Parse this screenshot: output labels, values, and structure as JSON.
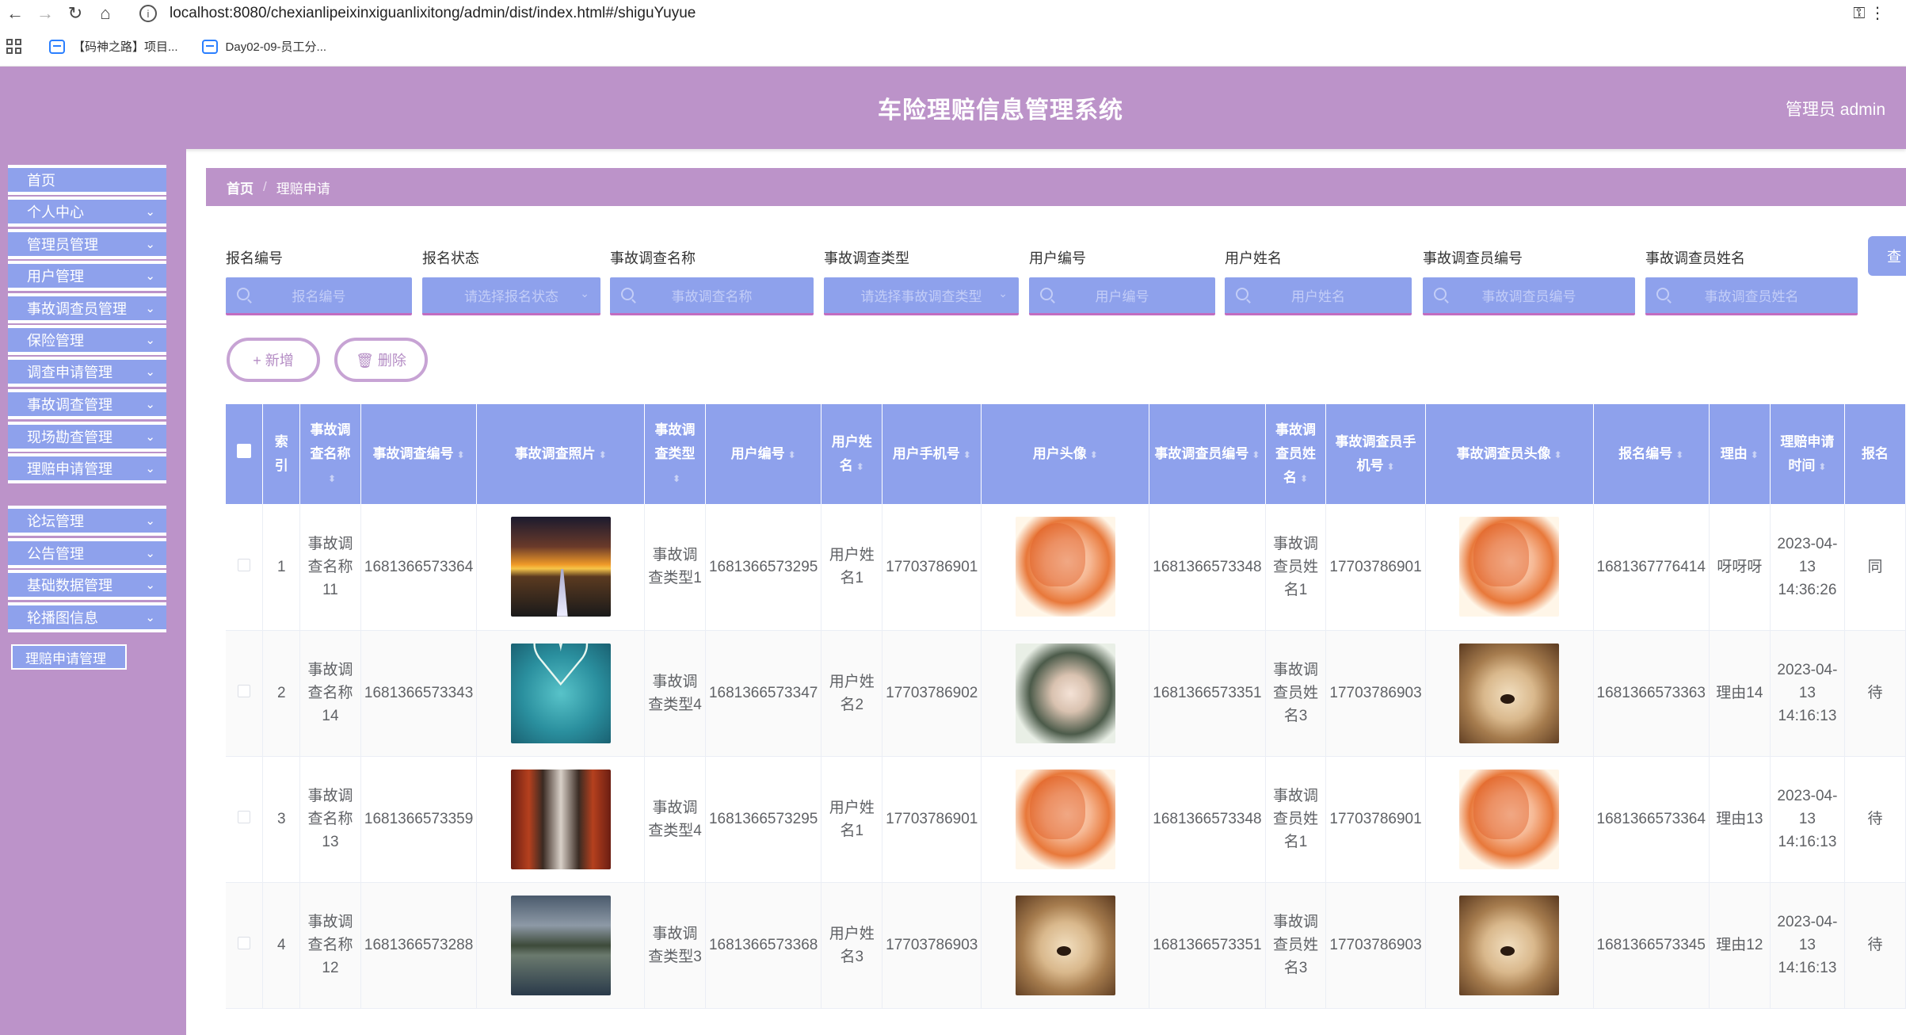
{
  "browser": {
    "url": "localhost:8080/chexianlipeixinxiguanlixitong/admin/dist/index.html#/shiguYuyue",
    "bookmarks": [
      "【码神之路】项目...",
      "Day02-09-员工分..."
    ]
  },
  "header": {
    "title": "车险理赔信息管理系统",
    "user": "管理员 admin"
  },
  "sidebar": {
    "items": [
      {
        "label": "首页",
        "has_arrow": false
      },
      {
        "label": "个人中心",
        "has_arrow": true
      },
      {
        "label": "管理员管理",
        "has_arrow": true
      },
      {
        "label": "用户管理",
        "has_arrow": true
      },
      {
        "label": "事故调查员管理",
        "has_arrow": true
      },
      {
        "label": "保险管理",
        "has_arrow": true
      },
      {
        "label": "调查申请管理",
        "has_arrow": true
      },
      {
        "label": "事故调查管理",
        "has_arrow": true
      },
      {
        "label": "现场勘查管理",
        "has_arrow": true
      },
      {
        "label": "理赔申请管理",
        "has_arrow": true
      },
      {
        "label": "论坛管理",
        "has_arrow": true
      },
      {
        "label": "公告管理",
        "has_arrow": true
      },
      {
        "label": "基础数据管理",
        "has_arrow": true
      },
      {
        "label": "轮播图信息",
        "has_arrow": true
      }
    ],
    "active_sub": "理赔申请管理"
  },
  "breadcrumb": {
    "home": "首页",
    "sep": "/",
    "current": "理赔申请"
  },
  "filters": [
    {
      "label": "报名编号",
      "placeholder": "报名编号",
      "type": "input"
    },
    {
      "label": "报名状态",
      "placeholder": "请选择报名状态",
      "type": "select"
    },
    {
      "label": "事故调查名称",
      "placeholder": "事故调查名称",
      "type": "input"
    },
    {
      "label": "事故调查类型",
      "placeholder": "请选择事故调查类型",
      "type": "select"
    },
    {
      "label": "用户编号",
      "placeholder": "用户编号",
      "type": "input"
    },
    {
      "label": "用户姓名",
      "placeholder": "用户姓名",
      "type": "input"
    },
    {
      "label": "事故调查员编号",
      "placeholder": "事故调查员编号",
      "type": "input"
    },
    {
      "label": "事故调查员姓名",
      "placeholder": "事故调查员姓名",
      "type": "input"
    }
  ],
  "search_label": "查",
  "actions": {
    "add": "+ 新增",
    "delete": "🗑 删除"
  },
  "table": {
    "columns": [
      "",
      "索引",
      "事故调查名称",
      "事故调查编号",
      "事故调查照片",
      "事故调查类型",
      "用户编号",
      "用户姓名",
      "用户手机号",
      "用户头像",
      "事故调查员编号",
      "事故调查员姓名",
      "事故调查员手机号",
      "事故调查员头像",
      "报名编号",
      "理由",
      "理赔申请时间",
      "报名"
    ],
    "rows": [
      {
        "index": "1",
        "name": "事故调查名称11",
        "code": "1681366573364",
        "photo": "sunset",
        "type": "事故调查类型1",
        "user_code": "1681366573295",
        "user_name": "用户姓名1",
        "user_phone": "17703786901",
        "user_avatar": "girl",
        "inv_code": "1681366573348",
        "inv_name": "事故调查员姓名1",
        "inv_phone": "17703786901",
        "inv_avatar": "girl",
        "reg_code": "1681367776414",
        "reason": "呀呀呀",
        "time": "2023-04-13 14:36:26",
        "status": "同"
      },
      {
        "index": "2",
        "name": "事故调查名称14",
        "code": "1681366573343",
        "photo": "heart",
        "type": "事故调查类型4",
        "user_code": "1681366573347",
        "user_name": "用户姓名2",
        "user_phone": "17703786902",
        "user_avatar": "boy",
        "inv_code": "1681366573351",
        "inv_name": "事故调查员姓名3",
        "inv_phone": "17703786903",
        "inv_avatar": "puppy",
        "reg_code": "1681366573363",
        "reason": "理由14",
        "time": "2023-04-13 14:16:13",
        "status": "待"
      },
      {
        "index": "3",
        "name": "事故调查名称13",
        "code": "1681366573359",
        "photo": "corridor",
        "type": "事故调查类型4",
        "user_code": "1681366573295",
        "user_name": "用户姓名1",
        "user_phone": "17703786901",
        "user_avatar": "girl",
        "inv_code": "1681366573348",
        "inv_name": "事故调查员姓名1",
        "inv_phone": "17703786901",
        "inv_avatar": "girl",
        "reg_code": "1681366573364",
        "reason": "理由13",
        "time": "2023-04-13 14:16:13",
        "status": "待"
      },
      {
        "index": "4",
        "name": "事故调查名称12",
        "code": "1681366573288",
        "photo": "lake",
        "type": "事故调查类型3",
        "user_code": "1681366573368",
        "user_name": "用户姓名3",
        "user_phone": "17703786903",
        "user_avatar": "puppy",
        "inv_code": "1681366573351",
        "inv_name": "事故调查员姓名3",
        "inv_phone": "17703786903",
        "inv_avatar": "puppy",
        "reg_code": "1681366573345",
        "reason": "理由12",
        "time": "2023-04-13 14:16:13",
        "status": "待"
      }
    ]
  }
}
